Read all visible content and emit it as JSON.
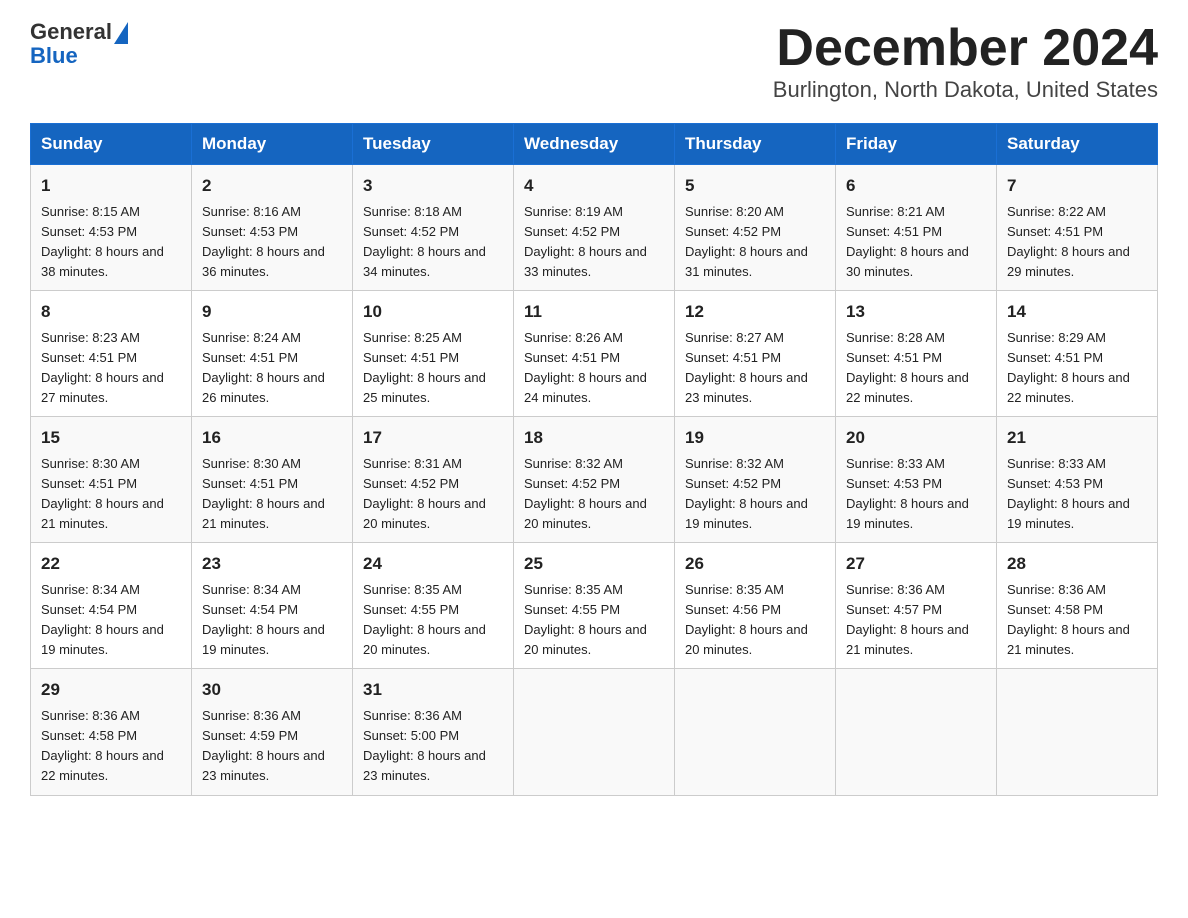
{
  "header": {
    "logo_general": "General",
    "logo_blue": "Blue",
    "title": "December 2024",
    "subtitle": "Burlington, North Dakota, United States"
  },
  "days_of_week": [
    "Sunday",
    "Monday",
    "Tuesday",
    "Wednesday",
    "Thursday",
    "Friday",
    "Saturday"
  ],
  "weeks": [
    [
      {
        "day": "1",
        "sunrise": "8:15 AM",
        "sunset": "4:53 PM",
        "daylight": "8 hours and 38 minutes."
      },
      {
        "day": "2",
        "sunrise": "8:16 AM",
        "sunset": "4:53 PM",
        "daylight": "8 hours and 36 minutes."
      },
      {
        "day": "3",
        "sunrise": "8:18 AM",
        "sunset": "4:52 PM",
        "daylight": "8 hours and 34 minutes."
      },
      {
        "day": "4",
        "sunrise": "8:19 AM",
        "sunset": "4:52 PM",
        "daylight": "8 hours and 33 minutes."
      },
      {
        "day": "5",
        "sunrise": "8:20 AM",
        "sunset": "4:52 PM",
        "daylight": "8 hours and 31 minutes."
      },
      {
        "day": "6",
        "sunrise": "8:21 AM",
        "sunset": "4:51 PM",
        "daylight": "8 hours and 30 minutes."
      },
      {
        "day": "7",
        "sunrise": "8:22 AM",
        "sunset": "4:51 PM",
        "daylight": "8 hours and 29 minutes."
      }
    ],
    [
      {
        "day": "8",
        "sunrise": "8:23 AM",
        "sunset": "4:51 PM",
        "daylight": "8 hours and 27 minutes."
      },
      {
        "day": "9",
        "sunrise": "8:24 AM",
        "sunset": "4:51 PM",
        "daylight": "8 hours and 26 minutes."
      },
      {
        "day": "10",
        "sunrise": "8:25 AM",
        "sunset": "4:51 PM",
        "daylight": "8 hours and 25 minutes."
      },
      {
        "day": "11",
        "sunrise": "8:26 AM",
        "sunset": "4:51 PM",
        "daylight": "8 hours and 24 minutes."
      },
      {
        "day": "12",
        "sunrise": "8:27 AM",
        "sunset": "4:51 PM",
        "daylight": "8 hours and 23 minutes."
      },
      {
        "day": "13",
        "sunrise": "8:28 AM",
        "sunset": "4:51 PM",
        "daylight": "8 hours and 22 minutes."
      },
      {
        "day": "14",
        "sunrise": "8:29 AM",
        "sunset": "4:51 PM",
        "daylight": "8 hours and 22 minutes."
      }
    ],
    [
      {
        "day": "15",
        "sunrise": "8:30 AM",
        "sunset": "4:51 PM",
        "daylight": "8 hours and 21 minutes."
      },
      {
        "day": "16",
        "sunrise": "8:30 AM",
        "sunset": "4:51 PM",
        "daylight": "8 hours and 21 minutes."
      },
      {
        "day": "17",
        "sunrise": "8:31 AM",
        "sunset": "4:52 PM",
        "daylight": "8 hours and 20 minutes."
      },
      {
        "day": "18",
        "sunrise": "8:32 AM",
        "sunset": "4:52 PM",
        "daylight": "8 hours and 20 minutes."
      },
      {
        "day": "19",
        "sunrise": "8:32 AM",
        "sunset": "4:52 PM",
        "daylight": "8 hours and 19 minutes."
      },
      {
        "day": "20",
        "sunrise": "8:33 AM",
        "sunset": "4:53 PM",
        "daylight": "8 hours and 19 minutes."
      },
      {
        "day": "21",
        "sunrise": "8:33 AM",
        "sunset": "4:53 PM",
        "daylight": "8 hours and 19 minutes."
      }
    ],
    [
      {
        "day": "22",
        "sunrise": "8:34 AM",
        "sunset": "4:54 PM",
        "daylight": "8 hours and 19 minutes."
      },
      {
        "day": "23",
        "sunrise": "8:34 AM",
        "sunset": "4:54 PM",
        "daylight": "8 hours and 19 minutes."
      },
      {
        "day": "24",
        "sunrise": "8:35 AM",
        "sunset": "4:55 PM",
        "daylight": "8 hours and 20 minutes."
      },
      {
        "day": "25",
        "sunrise": "8:35 AM",
        "sunset": "4:55 PM",
        "daylight": "8 hours and 20 minutes."
      },
      {
        "day": "26",
        "sunrise": "8:35 AM",
        "sunset": "4:56 PM",
        "daylight": "8 hours and 20 minutes."
      },
      {
        "day": "27",
        "sunrise": "8:36 AM",
        "sunset": "4:57 PM",
        "daylight": "8 hours and 21 minutes."
      },
      {
        "day": "28",
        "sunrise": "8:36 AM",
        "sunset": "4:58 PM",
        "daylight": "8 hours and 21 minutes."
      }
    ],
    [
      {
        "day": "29",
        "sunrise": "8:36 AM",
        "sunset": "4:58 PM",
        "daylight": "8 hours and 22 minutes."
      },
      {
        "day": "30",
        "sunrise": "8:36 AM",
        "sunset": "4:59 PM",
        "daylight": "8 hours and 23 minutes."
      },
      {
        "day": "31",
        "sunrise": "8:36 AM",
        "sunset": "5:00 PM",
        "daylight": "8 hours and 23 minutes."
      },
      null,
      null,
      null,
      null
    ]
  ],
  "labels": {
    "sunrise_prefix": "Sunrise: ",
    "sunset_prefix": "Sunset: ",
    "daylight_prefix": "Daylight: "
  }
}
